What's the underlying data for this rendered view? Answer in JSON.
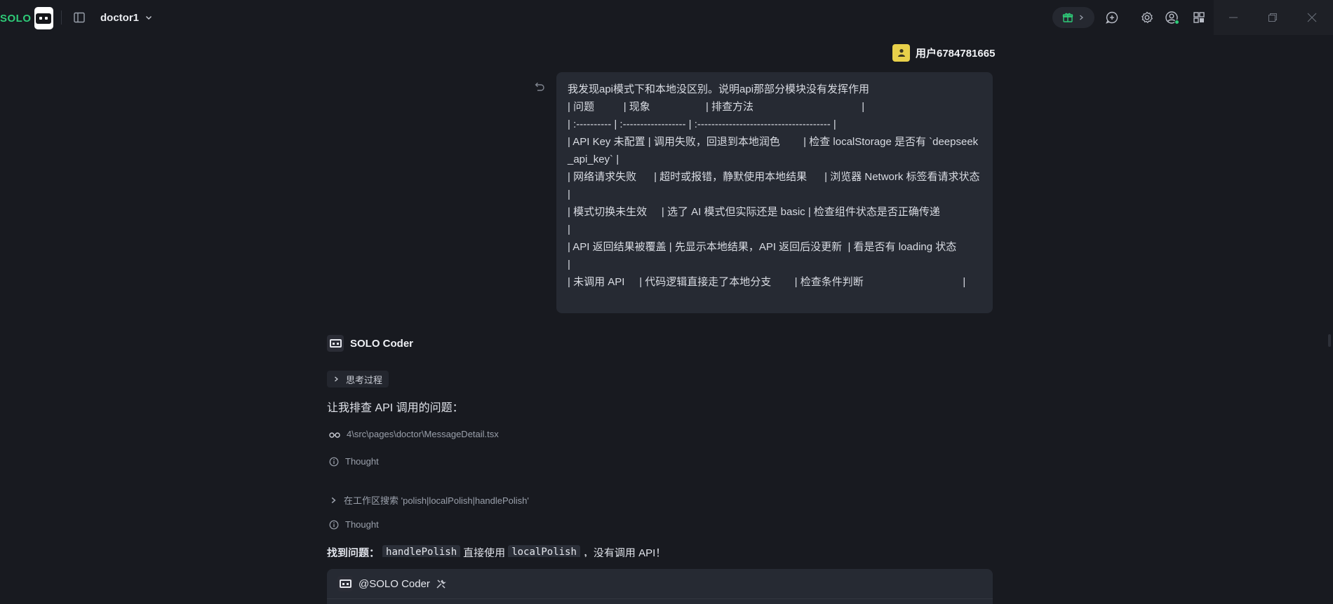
{
  "app": {
    "logo_text": "SOLO",
    "project_name": "doctor1"
  },
  "colors": {
    "accent": "#2ecb78",
    "background": "#181a20",
    "bubble": "#262a33",
    "user_avatar": "#e8d04a"
  },
  "topbar": {
    "icons": [
      "sidebar-toggle-icon",
      "gift-icon",
      "chat-plus-icon",
      "gear-icon",
      "account-icon",
      "apps-grid-icon"
    ],
    "window_controls": [
      "minimize",
      "restore",
      "close"
    ]
  },
  "user_message": {
    "username": "用户6784781665",
    "lines": [
      "我发现api模式下和本地没区别。说明api那部分模块没有发挥作用",
      "| 问题          | 现象                   | 排查方法                                     |",
      "| :---------- | :------------------ | :-------------------------------------- |",
      "| API Key 未配置 | 调用失败，回退到本地润色        | 检查 localStorage 是否有 `deepseek_api_key` |",
      "| 网络请求失败      | 超时或报错，静默使用本地结果      | 浏览器 Network 标签看请求状态                   |",
      "| 模式切换未生效     | 选了 AI 模式但实际还是 basic | 检查组件状态是否正确传递                            |",
      "| API 返回结果被覆盖 | 先显示本地结果，API 返回后没更新  | 看是否有 loading 状态                        |",
      "| 未调用 API     | 代码逻辑直接走了本地分支        | 检查条件判断                                  |"
    ]
  },
  "assistant": {
    "name": "SOLO Coder",
    "thinking_label": "思考过程",
    "intro": "让我排查 API 调用的问题：",
    "steps": [
      {
        "icon": "glasses-icon",
        "text": "4\\src\\pages\\doctor\\MessageDetail.tsx"
      },
      {
        "icon": "info-icon",
        "text": "Thought"
      },
      {
        "icon": "chevron-right-icon",
        "text": "在工作区搜索 'polish|localPolish|handlePolish'"
      },
      {
        "icon": "info-icon",
        "text": "Thought"
      }
    ],
    "finding": {
      "prefix": "找到问题：",
      "code1": "handlePolish",
      "mid": "直接使用",
      "code2": "localPolish",
      "suffix": "，没有调用 API！"
    }
  },
  "composer": {
    "mention": "@SOLO Coder"
  }
}
